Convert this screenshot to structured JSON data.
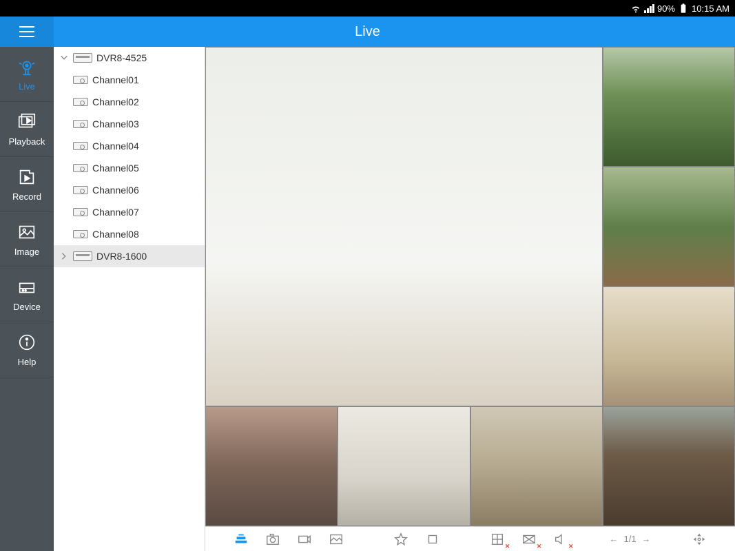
{
  "status": {
    "battery": "90%",
    "time": "10:15 AM"
  },
  "titlebar": {
    "title": "Live"
  },
  "sidebar": {
    "items": [
      {
        "label": "Live",
        "active": true
      },
      {
        "label": "Playback",
        "active": false
      },
      {
        "label": "Record",
        "active": false
      },
      {
        "label": "Image",
        "active": false
      },
      {
        "label": "Device",
        "active": false
      },
      {
        "label": "Help",
        "active": false
      }
    ]
  },
  "tree": {
    "devices": [
      {
        "name": "DVR8-4525",
        "expanded": true,
        "channels": [
          "Channel01",
          "Channel02",
          "Channel03",
          "Channel04",
          "Channel05",
          "Channel06",
          "Channel07",
          "Channel08"
        ]
      },
      {
        "name": "DVR8-1600",
        "expanded": false,
        "channels": []
      }
    ]
  },
  "toolbar": {
    "page_current": "1",
    "page_total": "1",
    "page_sep": "/"
  },
  "icons": {
    "menu": "menu-icon",
    "live": "camera-icon",
    "playback": "film-icon",
    "record": "record-icon",
    "image": "image-icon",
    "device": "device-icon",
    "help": "info-icon"
  }
}
